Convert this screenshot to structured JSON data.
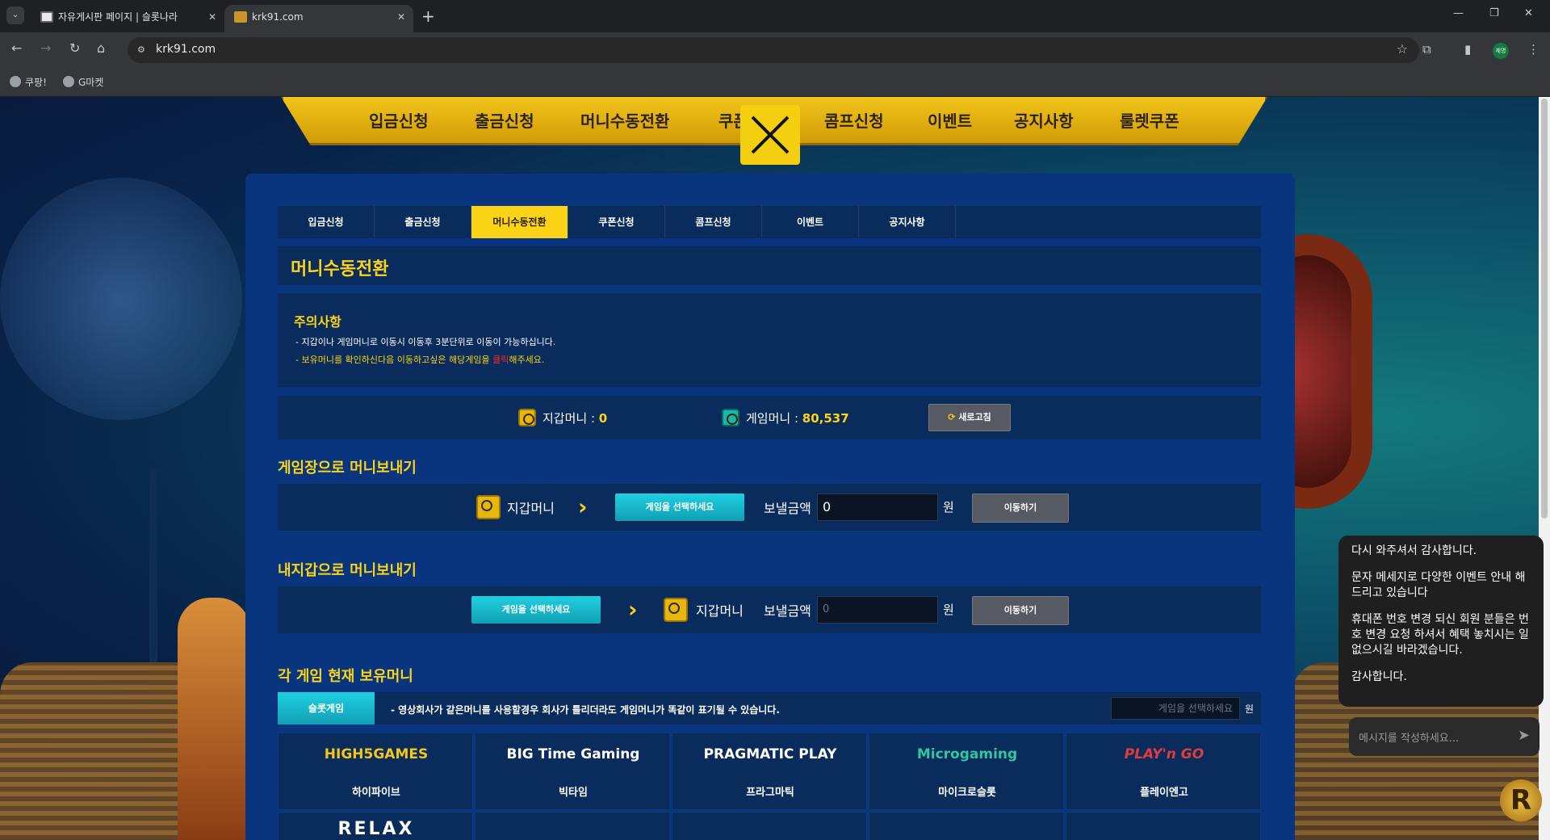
{
  "browser": {
    "tabs": [
      {
        "title": "자유게시판 페이지 | 슬롯나라"
      },
      {
        "title": "krk91.com"
      }
    ],
    "url": "krk91.com",
    "bookmarks": [
      "쿠팡!",
      "G마켓"
    ],
    "profile_label": "제명"
  },
  "top_nav": {
    "items": [
      "입금신청",
      "출금신청",
      "머니수동전환",
      "쿠폰",
      "콤프신청",
      "이벤트",
      "공지사항",
      "룰렛쿠폰"
    ]
  },
  "sub_tabs": [
    "입금신청",
    "출금신청",
    "머니수동전환",
    "쿠폰신청",
    "콤프신청",
    "이벤트",
    "공지사항"
  ],
  "active_sub_tab": "머니수동전환",
  "page_title": "머니수동전환",
  "notice": {
    "heading": "주의사항",
    "line1": "- 지갑이나 게임머니로 이동시 이동후 3분단위로 이동이 가능하십니다.",
    "line2_before": "- 보유머니를 확인하신다음 이동하고싶은 해당게임을 ",
    "line2_highlight": "클릭",
    "line2_after": "해주세요."
  },
  "balance": {
    "wallet_label": "지갑머니 : ",
    "wallet_value": "0",
    "game_label": "게임머니 : ",
    "game_value": "80,537",
    "refresh_label": "새로고침"
  },
  "to_game": {
    "heading": "게임장으로 머니보내기",
    "wallet_label": "지갑머니",
    "select_label": "게임을 선택하세요",
    "amount_label": "보낼금액",
    "amount_value": "0",
    "won": "원",
    "move_label": "이동하기"
  },
  "to_wallet": {
    "heading": "내지갑으로 머니보내기",
    "select_label": "게임을 선택하세요",
    "wallet_label": "지갑머니",
    "amount_label": "보낼금액",
    "amount_placeholder": "0",
    "won": "원",
    "move_label": "이동하기"
  },
  "holdings": {
    "heading": "각 게임 현재 보유머니",
    "tab_label": "슬롯게임",
    "note": "- 영상회사가 같은머니를 사용할경우 회사가 틀리더라도 게임머니가 똑같이 표기될 수 있습니다.",
    "select_placeholder": "게임을 선택하세요",
    "won": "원"
  },
  "providers": [
    {
      "logo": "HIGH5GAMES",
      "name": "하이파이브",
      "color": "#f5c518"
    },
    {
      "logo": "BIG Time Gaming",
      "name": "빅타임",
      "color": "#ffffff"
    },
    {
      "logo": "PRAGMATIC PLAY",
      "name": "프라그마틱",
      "color": "#ffffff"
    },
    {
      "logo": "Microgaming",
      "name": "마이크로슬롯",
      "color": "#2fc6a0"
    },
    {
      "logo": "PLAY'n GO",
      "name": "플레이엔고",
      "color": "#e33b3b"
    }
  ],
  "providers_row2_logo": "RELAX",
  "chat": {
    "messages": [
      "다시 와주셔서 감사합니다.",
      "문자 메세지로 다양한 이벤트 안내 해드리고 있습니다",
      "휴대폰 번호 변경 되신 회원 분들은 번호 변경 요청 하셔서 혜택 놓치시는 일 없으시길 바라겠습니다.",
      "감사합니다."
    ],
    "input_placeholder": "메시지를 작성하세요..."
  },
  "colors": {
    "accent": "#fbd317",
    "panel": "#08357e",
    "teal": "#1fd0e0"
  }
}
